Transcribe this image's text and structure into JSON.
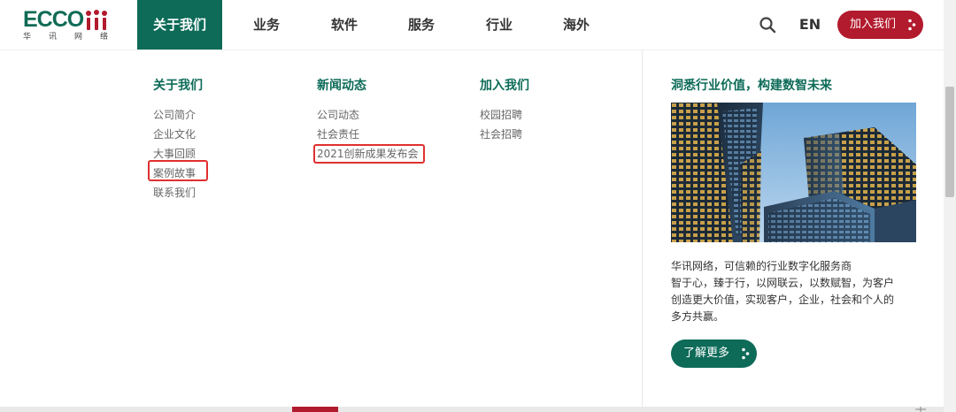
{
  "logo": {
    "wordmark": "ECCO",
    "subtitle_chars": [
      "华",
      "讯",
      "网",
      "络"
    ],
    "brand_green": "#0f6b55",
    "brand_red": "#b21a2d"
  },
  "nav": {
    "items": [
      {
        "label": "关于我们",
        "active": true
      },
      {
        "label": "业务",
        "active": false
      },
      {
        "label": "软件",
        "active": false
      },
      {
        "label": "服务",
        "active": false
      },
      {
        "label": "行业",
        "active": false
      },
      {
        "label": "海外",
        "active": false
      }
    ],
    "search_icon": "search-icon",
    "lang": "EN",
    "join_button": "加入我们"
  },
  "dropdown": {
    "columns": [
      {
        "title": "关于我们",
        "links": [
          "公司简介",
          "企业文化",
          "大事回顾",
          "案例故事",
          "联系我们"
        ]
      },
      {
        "title": "新闻动态",
        "links": [
          "公司动态",
          "社会责任",
          "2021创新成果发布会"
        ]
      },
      {
        "title": "加入我们",
        "links": [
          "校园招聘",
          "社会招聘"
        ]
      }
    ],
    "highlighted_links": [
      "案例故事",
      "2021创新成果发布会"
    ],
    "highlight_color": "#e03030"
  },
  "promo": {
    "title": "洞悉行业价值，构建数智未来",
    "image": "city-skyscrapers-image",
    "text_lines": [
      "华讯网络，可信赖的行业数字化服务商",
      "智于心，臻于行，以网联云，以数赋智，为客户",
      "创造更大价值，实现客户，企业，社会和个人的",
      "多方共赢。"
    ],
    "button": "了解更多"
  },
  "colors": {
    "accent_green": "#0d6b58",
    "accent_red": "#b21a2d"
  }
}
